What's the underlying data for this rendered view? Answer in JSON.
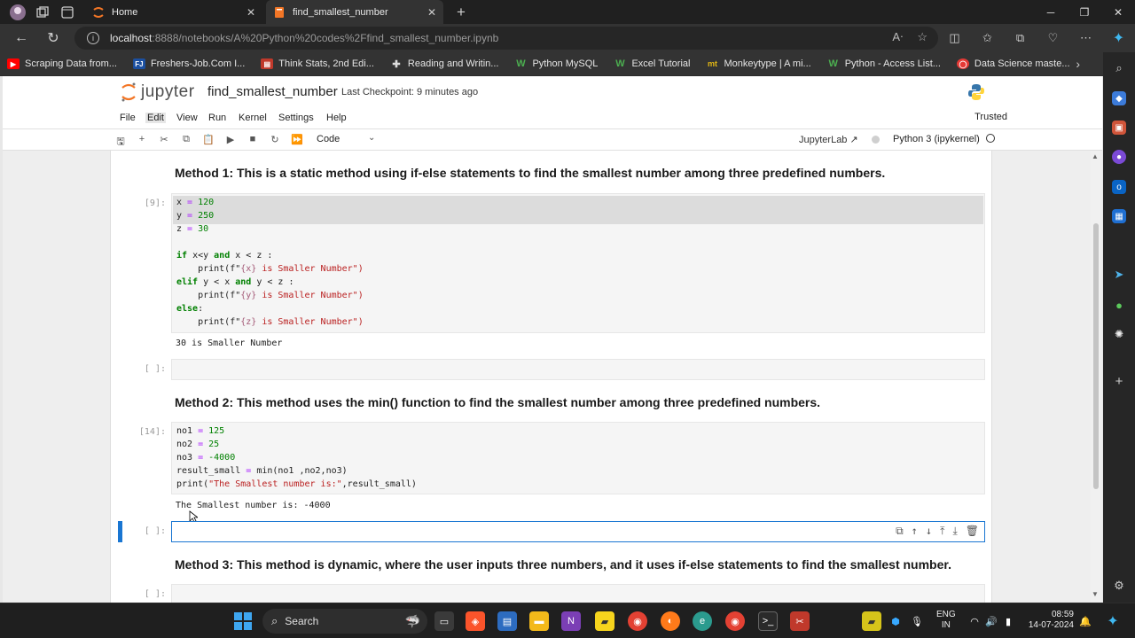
{
  "browser": {
    "tabs": [
      {
        "title": "Home",
        "active": false
      },
      {
        "title": "find_smallest_number",
        "active": true
      }
    ],
    "new_tab": "+",
    "url_host": "localhost",
    "url_rest": ":8888/notebooks/A%20Python%20codes%2Ffind_smallest_number.ipynb",
    "bookmarks": [
      {
        "label": "Scraping Data from...",
        "color": "#ff0000",
        "icon": "youtube-icon"
      },
      {
        "label": "Freshers-Job.Com I...",
        "color": "#1b4fa0",
        "icon": "fj-icon"
      },
      {
        "label": "Think Stats, 2nd Edi...",
        "color": "#c0392b",
        "icon": "book-icon"
      },
      {
        "label": "Reading and Writin...",
        "color": "#2e8b57",
        "icon": "puzzle-icon"
      },
      {
        "label": "Python MySQL",
        "color": "#2e7d32",
        "icon": "w3-icon"
      },
      {
        "label": "Excel Tutorial",
        "color": "#2e7d32",
        "icon": "w3-icon"
      },
      {
        "label": "Monkeytype | A mi...",
        "color": "#e2b714",
        "icon": "mt-icon"
      },
      {
        "label": "Python - Access List...",
        "color": "#2e7d32",
        "icon": "w3-icon"
      },
      {
        "label": "Data Science maste...",
        "color": "#e53935",
        "icon": "ds-icon"
      }
    ]
  },
  "jupyter": {
    "logo_word": "jupyter",
    "notebook_name": "find_smallest_number",
    "checkpoint": "Last Checkpoint: 9 minutes ago",
    "menu": [
      "File",
      "Edit",
      "Run",
      "View",
      "Kernel",
      "Settings",
      "Help"
    ],
    "menu_display": [
      "File",
      "Edit",
      "View",
      "Run",
      "Kernel",
      "Settings",
      "Help"
    ],
    "trusted": "Trusted",
    "cell_type": "Code",
    "jupyterlab_link": "JupyterLab",
    "kernel_name": "Python 3 (ipykernel)"
  },
  "notebook": {
    "md1": "Method 1: This is a static method using if-else statements to find the smallest number among three predefined numbers.",
    "cell1_prompt": "[9]:",
    "cell1_out": "30 is Smaller Number",
    "cell2_prompt": "[ ]:",
    "md2": "Method 2: This method uses the min() function to find the smallest number among three predefined numbers.",
    "cell3_prompt": "[14]:",
    "cell3_out": "The Smallest number is: -4000",
    "cell4_prompt": "[ ]:",
    "md3": "Method 3: This method is dynamic, where the user inputs three numbers, and it uses if-else statements to find the smallest number.",
    "cell5_prompt": "[ ]:"
  },
  "code1": {
    "l1": [
      "x",
      " = ",
      "120"
    ],
    "l2": [
      "y",
      " = ",
      "250"
    ],
    "l3": [
      "z",
      " = ",
      "30"
    ],
    "l5": [
      "if",
      " x<y ",
      "and",
      " x < z :"
    ],
    "l6": [
      "    print(f\"",
      "{x}",
      " is Smaller Number\")"
    ],
    "l7": [
      "elif",
      " y < x ",
      "and",
      " y < z :"
    ],
    "l8": [
      "    print(f\"",
      "{y}",
      " is Smaller Number\")"
    ],
    "l9": [
      "else",
      ":"
    ],
    "l10": [
      "    print(f\"",
      "{z}",
      " is Smaller Number\")"
    ]
  },
  "code2": {
    "l1": [
      "no1",
      " = ",
      "125"
    ],
    "l2": [
      "no2",
      " = ",
      "25"
    ],
    "l3": [
      "no3",
      " = ",
      "-4000"
    ],
    "l4": [
      "result_small",
      " = ",
      "min(no1 ,no2,no3)"
    ],
    "l5": [
      "print(",
      "\"The Smallest number is:\"",
      ",result_small)"
    ]
  },
  "taskbar": {
    "search": "Search",
    "lang_top": "ENG",
    "lang_bottom": "IN",
    "time": "08:59",
    "date": "14-07-2024"
  }
}
